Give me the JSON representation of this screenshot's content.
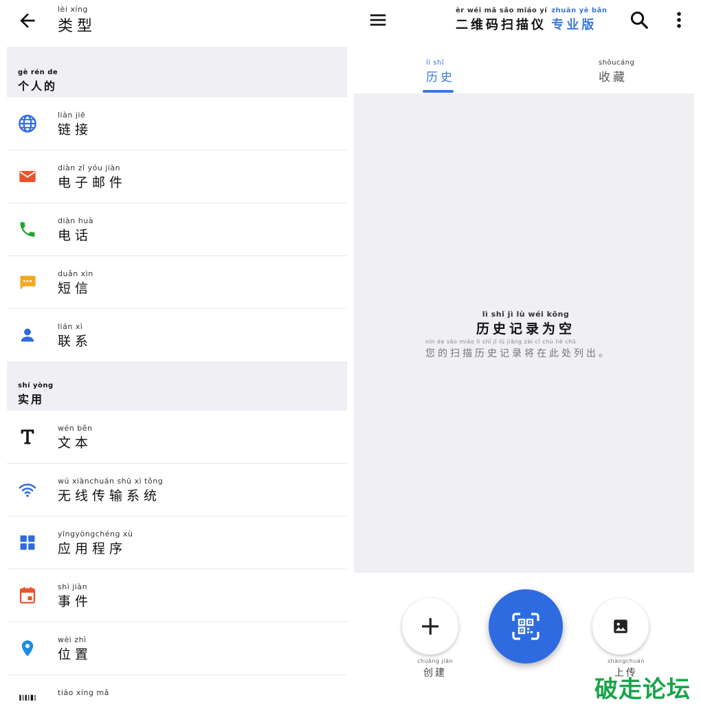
{
  "left": {
    "header": {
      "title_py": "lèi xíng",
      "title": "类型"
    },
    "sections": [
      {
        "py": "gè rén de",
        "label": "个人的"
      },
      {
        "py": "shí yòng",
        "label": "实用"
      }
    ],
    "items": [
      {
        "py": "liàn jiē",
        "label": "链接",
        "icon": "globe-icon"
      },
      {
        "py": "diàn zǐ yóu jiàn",
        "label": "电子邮件",
        "icon": "email-icon"
      },
      {
        "py": "diàn huà",
        "label": "电话",
        "icon": "phone-icon"
      },
      {
        "py": "duǎn xìn",
        "label": "短信",
        "icon": "sms-icon"
      },
      {
        "py": "lián xì",
        "label": "联系",
        "icon": "contact-icon"
      },
      {
        "py": "wén běn",
        "label": "文本",
        "icon": "text-icon"
      },
      {
        "py": "wú xiànchuán shū xì tǒng",
        "label": "无线传输系统",
        "icon": "wifi-icon"
      },
      {
        "py": "yīngyòngchéng xù",
        "label": "应用程序",
        "icon": "apps-icon"
      },
      {
        "py": "shì jiàn",
        "label": "事件",
        "icon": "calendar-icon"
      },
      {
        "py": "wèi zhì",
        "label": "位置",
        "icon": "location-icon"
      },
      {
        "py": "tiáo xíng mǎ",
        "label": "",
        "icon": "barcode-icon"
      }
    ]
  },
  "right": {
    "app_title": {
      "main_py": "èr wéi mǎ sǎo miáo yí",
      "main": "二维码扫描仪",
      "pro_py": "zhuān yè bǎn",
      "pro": "专业版"
    },
    "tabs": [
      {
        "py": "lì shǐ",
        "label": "历史"
      },
      {
        "py": "shōucáng",
        "label": "收藏"
      }
    ],
    "empty": {
      "title_py": "lì shǐ jì lù wéi kōng",
      "title": "历史记录为空",
      "sub_py": "nín de sǎo miáo lì shǐ jì lù jiāng zài cǐ chù liè chū",
      "sub": "您的扫描历史记录将在此处列出。"
    },
    "bottom": {
      "create_py": "chuàng jiàn",
      "create": "创建",
      "upload_py": "shàngchuán",
      "upload": "上传"
    },
    "colors": {
      "accent": "#3b76e0",
      "scan_button": "#2f6be0"
    }
  },
  "watermark": "破走论坛"
}
